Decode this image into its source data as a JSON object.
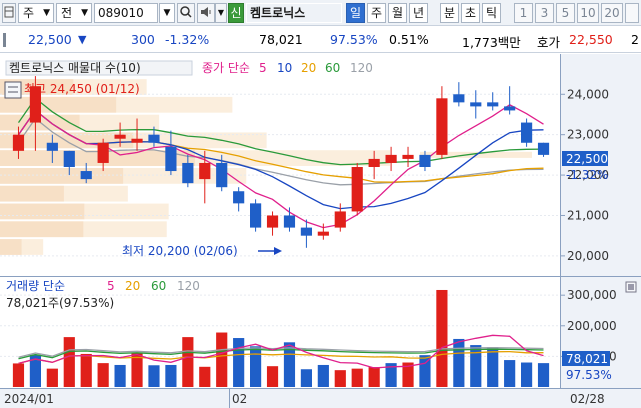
{
  "toolbar": {
    "type_label": "주",
    "type_label2": "전",
    "code": "089010",
    "badge": "신",
    "stock_name": "켐트로닉스",
    "periods": [
      "일",
      "주",
      "월",
      "년",
      "분",
      "초",
      "틱"
    ],
    "active_period": "일",
    "intervals": [
      "1",
      "3",
      "5",
      "10",
      "20"
    ]
  },
  "quote": {
    "price": "22,500",
    "change": "300",
    "change_pct": "-1.32%",
    "volume": "78,021",
    "vol_ratio": "97.53%",
    "turnover": "0.51%",
    "amount": "1,773백만",
    "ask_label": "호가",
    "ask_price": "22,550",
    "more": "2"
  },
  "price_panel": {
    "legend_title": "켐트로닉스 매물대 수(10)",
    "ma_label": "종가 단순",
    "ma_periods": [
      "5",
      "10",
      "20",
      "60",
      "120"
    ],
    "ma_colors": [
      "#e0208c",
      "#1846c2",
      "#e6a000",
      "#2a9a3a",
      "#9aa0a8"
    ],
    "high_label": "최고 24,450 (01/12)",
    "low_label": "최저 20,200 (02/06)",
    "current_price_tag": "22,500",
    "current_change_tag": "-1.32%"
  },
  "volume_panel": {
    "legend_title": "거래량 단순",
    "ma_periods": [
      "5",
      "20",
      "60",
      "120"
    ],
    "value_label": "78,021주(97.53%)",
    "current_tag": "78,021",
    "current_pct_tag": "97.53%"
  },
  "date_axis": [
    "2024/01",
    "02",
    "02/28"
  ],
  "chart_data": [
    {
      "type": "candlestick",
      "title": "켐트로닉스 매물대 수(10)",
      "y_ticks": [
        20000,
        21000,
        22000,
        23000,
        24000
      ],
      "ylim": [
        19700,
        24700
      ],
      "candles": [
        {
          "o": 22600,
          "h": 23200,
          "l": 22400,
          "c": 23000
        },
        {
          "o": 23300,
          "h": 24450,
          "l": 22600,
          "c": 24200
        },
        {
          "o": 22800,
          "h": 23000,
          "l": 22300,
          "c": 22600
        },
        {
          "o": 22600,
          "h": 22600,
          "l": 22000,
          "c": 22200
        },
        {
          "o": 22100,
          "h": 22300,
          "l": 21800,
          "c": 21900
        },
        {
          "o": 22300,
          "h": 22900,
          "l": 22100,
          "c": 22800
        },
        {
          "o": 22900,
          "h": 23300,
          "l": 22700,
          "c": 23000
        },
        {
          "o": 22800,
          "h": 23400,
          "l": 22600,
          "c": 22900
        },
        {
          "o": 23000,
          "h": 23200,
          "l": 22700,
          "c": 22800
        },
        {
          "o": 22700,
          "h": 23100,
          "l": 22000,
          "c": 22100
        },
        {
          "o": 22300,
          "h": 22500,
          "l": 21700,
          "c": 21800
        },
        {
          "o": 21900,
          "h": 22600,
          "l": 21300,
          "c": 22300
        },
        {
          "o": 22300,
          "h": 22500,
          "l": 21600,
          "c": 21700
        },
        {
          "o": 21600,
          "h": 21700,
          "l": 21100,
          "c": 21300
        },
        {
          "o": 21300,
          "h": 21400,
          "l": 20600,
          "c": 20700
        },
        {
          "o": 20700,
          "h": 21100,
          "l": 20500,
          "c": 21000
        },
        {
          "o": 21000,
          "h": 21200,
          "l": 20600,
          "c": 20700
        },
        {
          "o": 20700,
          "h": 20900,
          "l": 20200,
          "c": 20500
        },
        {
          "o": 20500,
          "h": 20800,
          "l": 20400,
          "c": 20600
        },
        {
          "o": 20700,
          "h": 21300,
          "l": 20600,
          "c": 21100
        },
        {
          "o": 21100,
          "h": 22300,
          "l": 21000,
          "c": 22200
        },
        {
          "o": 22200,
          "h": 22600,
          "l": 21900,
          "c": 22400
        },
        {
          "o": 22300,
          "h": 22700,
          "l": 22100,
          "c": 22500
        },
        {
          "o": 22400,
          "h": 22700,
          "l": 22200,
          "c": 22500
        },
        {
          "o": 22500,
          "h": 22600,
          "l": 22100,
          "c": 22200
        },
        {
          "o": 22500,
          "h": 24200,
          "l": 22400,
          "c": 23900
        },
        {
          "o": 24000,
          "h": 24300,
          "l": 23700,
          "c": 23800
        },
        {
          "o": 23800,
          "h": 24100,
          "l": 23400,
          "c": 23700
        },
        {
          "o": 23800,
          "h": 24050,
          "l": 23600,
          "c": 23700
        },
        {
          "o": 23700,
          "h": 24200,
          "l": 23500,
          "c": 23600
        },
        {
          "o": 23300,
          "h": 23400,
          "l": 22700,
          "c": 22800
        },
        {
          "o": 22800,
          "h": 22800,
          "l": 22450,
          "c": 22500
        }
      ]
    },
    {
      "type": "bar",
      "title": "거래량",
      "y_ticks": [
        100000,
        200000,
        300000
      ],
      "ylim": [
        0,
        330000
      ],
      "values": [
        77000,
        105000,
        60000,
        163000,
        108000,
        78000,
        72000,
        110000,
        71000,
        72000,
        163000,
        66000,
        178000,
        160000,
        133000,
        68000,
        146000,
        58000,
        72000,
        55000,
        60000,
        65000,
        78000,
        80000,
        104000,
        317000,
        157000,
        137000,
        130000,
        88000,
        80000,
        78021
      ],
      "colors": [
        "r",
        "b",
        "r",
        "r",
        "r",
        "r",
        "b",
        "r",
        "b",
        "b",
        "r",
        "r",
        "r",
        "b",
        "b",
        "r",
        "b",
        "b",
        "b",
        "r",
        "r",
        "r",
        "b",
        "r",
        "b",
        "r",
        "b",
        "b",
        "b",
        "b",
        "b",
        "b"
      ]
    }
  ]
}
